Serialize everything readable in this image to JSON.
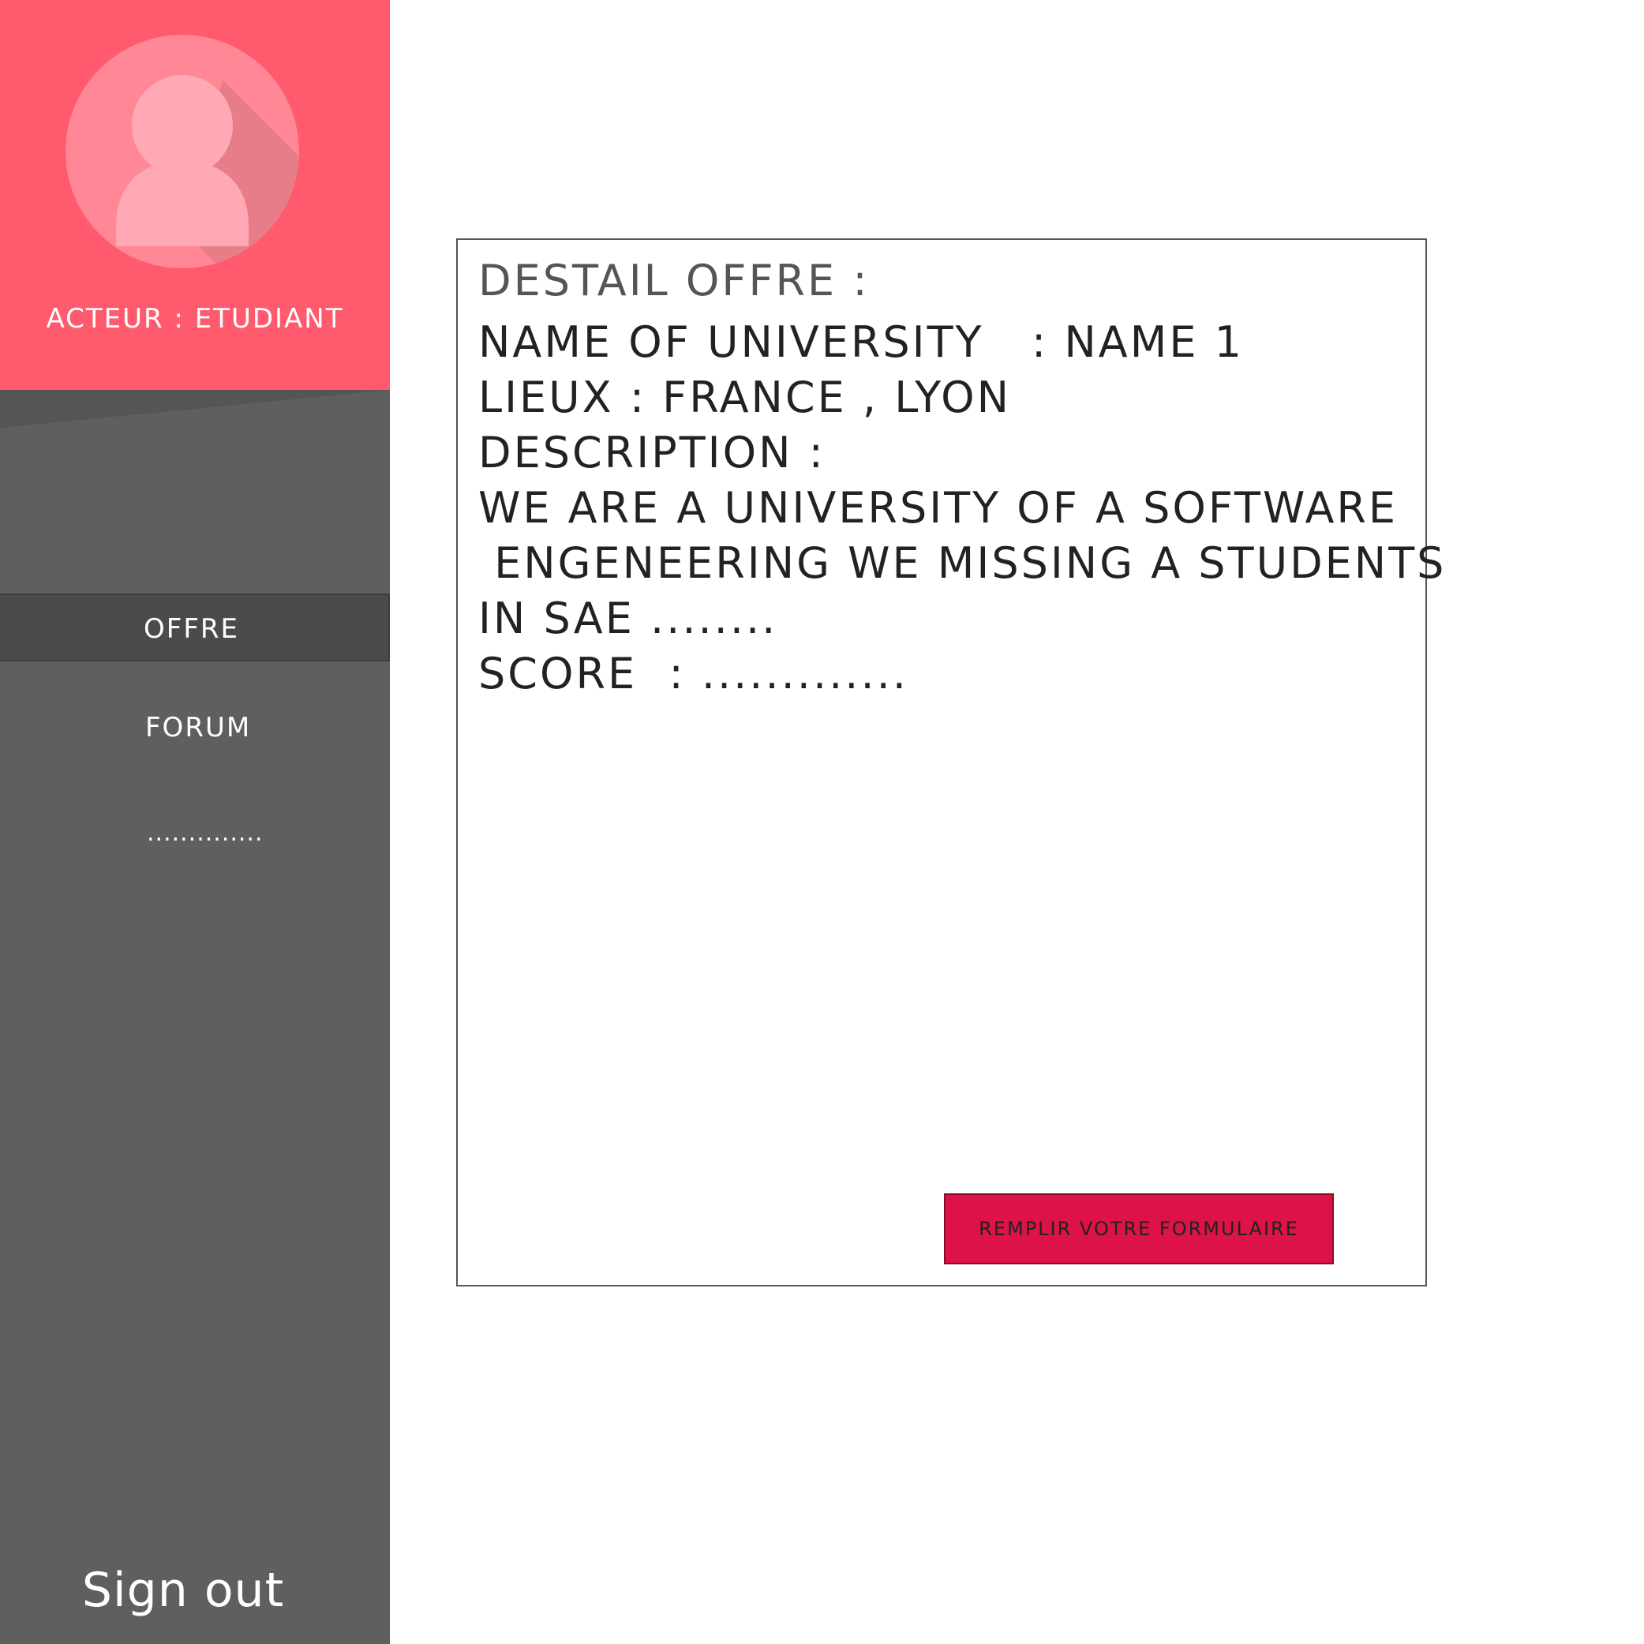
{
  "colors": {
    "profile_background": "#ff5a6d",
    "sidebar_background": "#5f5f5f",
    "active_nav_background": "#4b4b4b",
    "button_background": "#dd1246"
  },
  "sidebar": {
    "avatar_icon": "user-avatar-icon",
    "role_label": "ACTEUR : ETUDIANT",
    "nav_items": [
      {
        "label": "OFFRE",
        "active": true
      },
      {
        "label": "FORUM",
        "active": false
      },
      {
        "label": "..............",
        "active": false
      }
    ],
    "sign_out_label": "Sign out"
  },
  "offer": {
    "title": "DESTAIL OFFRE  :",
    "lines": [
      "NAME OF UNIVERSITY   : NAME 1",
      "LIEUX : FRANCE , LYON",
      "DESCRIPTION :",
      "WE ARE A UNIVERSITY OF A SOFTWARE",
      " ENGENEERING WE MISSING A STUDENTS",
      "IN SAE ........",
      "SCORE  : ............."
    ],
    "button_label": "REMPLIR VOTRE FORMULAIRE"
  }
}
